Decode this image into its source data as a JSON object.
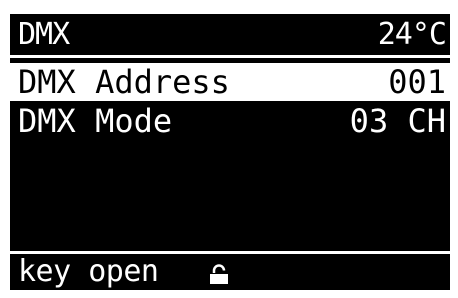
{
  "header": {
    "title": "DMX",
    "temperature": "24°C"
  },
  "menu": {
    "items": [
      {
        "label": "DMX Address",
        "value": "001",
        "selected": true
      },
      {
        "label": "DMX Mode",
        "value": "03 CH",
        "selected": false
      }
    ]
  },
  "footer": {
    "status_text": "key open",
    "icon": "unlocked-lock-icon"
  },
  "colors": {
    "background": "#000000",
    "foreground": "#ffffff"
  }
}
